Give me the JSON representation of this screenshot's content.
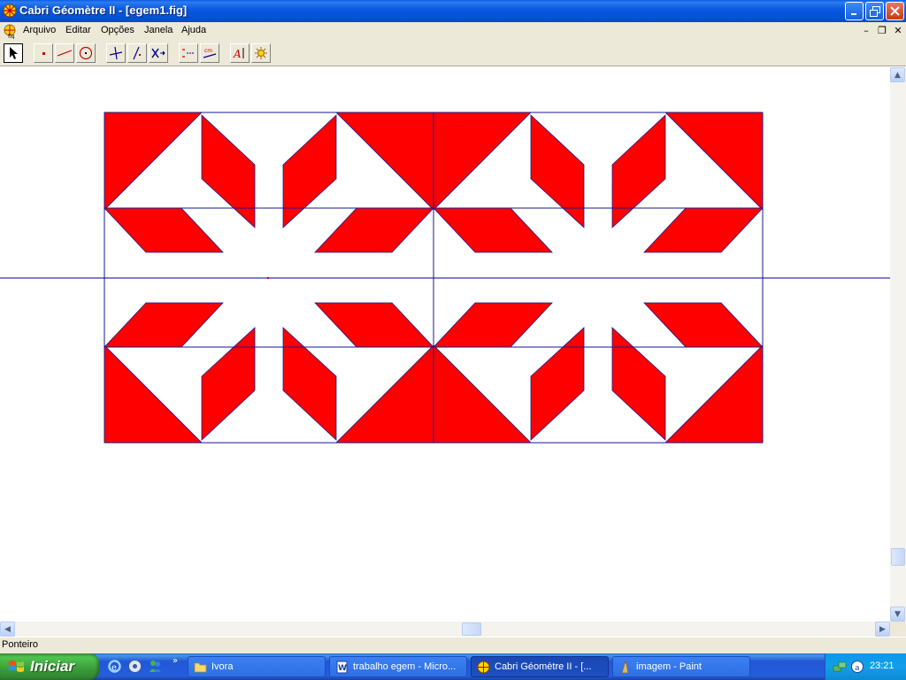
{
  "window": {
    "title": "Cabri Géomètre II - [egem1.fig]",
    "icon": "cabri-app-icon"
  },
  "menu": {
    "items": [
      "Arquivo",
      "Editar",
      "Opções",
      "Janela",
      "Ajuda"
    ]
  },
  "toolbar": {
    "tools": [
      {
        "icon": "pointer-tool-icon",
        "active": true
      },
      {
        "icon": "point-tool-icon"
      },
      {
        "icon": "line-tool-icon"
      },
      {
        "icon": "circle-tool-icon"
      },
      {
        "icon": "perpendicular-tool-icon"
      },
      {
        "icon": "midpoint-tool-icon"
      },
      {
        "icon": "transform-tool-icon"
      },
      {
        "icon": "macro-tool-icon"
      },
      {
        "icon": "measure-tool-icon"
      },
      {
        "icon": "text-tool-icon"
      },
      {
        "icon": "display-tool-icon"
      }
    ]
  },
  "canvas": {
    "fill_color": "#ff0000",
    "stroke_color": "#1a1a8c",
    "axis_color": "#00008b"
  },
  "statusbar": {
    "text": "Ponteiro"
  },
  "taskbar": {
    "start_label": "Iniciar",
    "tasks": [
      {
        "label": "Ivora",
        "icon": "folder-icon"
      },
      {
        "label": "trabalho egem - Micro...",
        "icon": "word-icon"
      },
      {
        "label": "Cabri Géomètre II - [...",
        "icon": "cabri-icon",
        "active": true
      },
      {
        "label": "imagem - Paint",
        "icon": "paint-icon"
      }
    ],
    "clock": "23:21"
  }
}
